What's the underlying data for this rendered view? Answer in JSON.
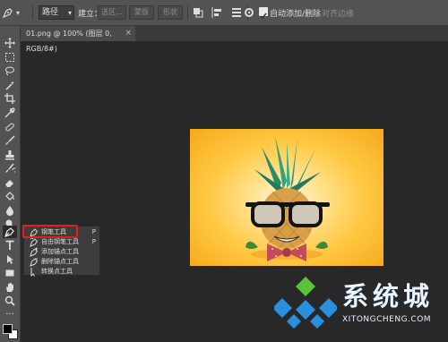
{
  "options_bar": {
    "mode": "路径",
    "make_label": "建立：",
    "selection_button": "选区...",
    "mask_button": "蒙版",
    "shape_button": "形状",
    "auto_add_delete_label": "自动添加/删除",
    "auto_add_delete_checked": true,
    "align_edges_label": "对齐边缘"
  },
  "document_tab": {
    "title": "01.png @ 100% (图层 0, RGB/8#)",
    "close": "×"
  },
  "flyout": {
    "items": [
      {
        "label": "钢笔工具",
        "shortcut": "P",
        "icon": "pen-icon"
      },
      {
        "label": "自由钢笔工具",
        "shortcut": "P",
        "icon": "freeform-pen-icon"
      },
      {
        "label": "添加锚点工具",
        "shortcut": "",
        "icon": "add-anchor-icon"
      },
      {
        "label": "删除锚点工具",
        "shortcut": "",
        "icon": "delete-anchor-icon"
      },
      {
        "label": "转换点工具",
        "shortcut": "",
        "icon": "convert-point-icon"
      }
    ]
  },
  "watermark": {
    "title": "系统城",
    "subtitle": "XITONGCHENG.COM"
  },
  "colors": {
    "highlight": "#e02020",
    "canvas_bg": "#ffc842",
    "app_bg": "#282828"
  }
}
